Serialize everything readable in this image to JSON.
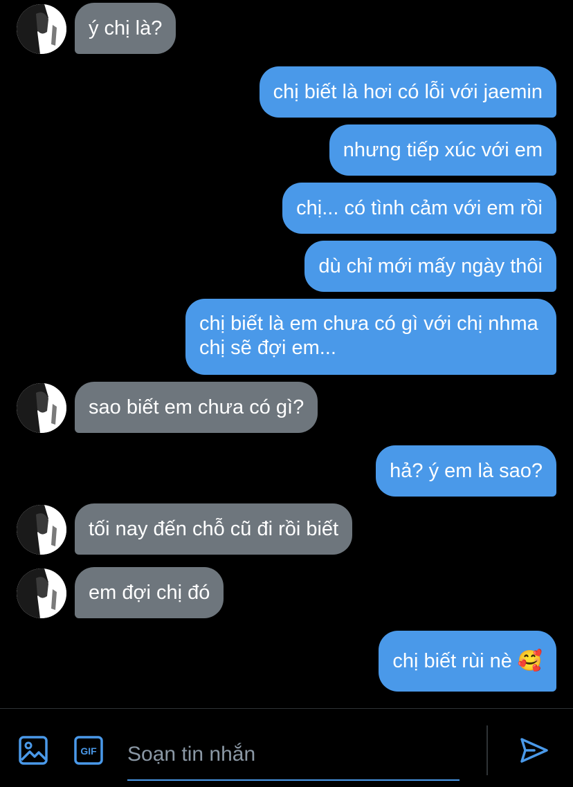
{
  "messages": [
    {
      "side": "in",
      "text": "ý chị là?"
    },
    {
      "side": "out",
      "text": "chị biết là hơi có lỗi với jaemin"
    },
    {
      "side": "out",
      "text": "nhưng tiếp xúc với em"
    },
    {
      "side": "out",
      "text": "chị... có tình cảm với em rồi"
    },
    {
      "side": "out",
      "text": "dù chỉ mới mấy ngày thôi"
    },
    {
      "side": "out",
      "text": "chị biết là em chưa có gì với chị nhma chị sẽ đợi em..."
    },
    {
      "side": "in",
      "text": "sao biết em chưa có gì?"
    },
    {
      "side": "out",
      "text": "hả? ý em là sao?"
    },
    {
      "side": "in",
      "text": "tối nay đến chỗ cũ đi rồi biết"
    },
    {
      "side": "in",
      "text": "em đợi chị đó"
    },
    {
      "side": "out",
      "text": "chị biết rùi nè 🥰"
    }
  ],
  "composer": {
    "placeholder": "Soạn tin nhắn",
    "gif_label": "GIF"
  },
  "colors": {
    "incoming_bubble": "#6e767d",
    "outgoing_bubble": "#4a99e9",
    "accent": "#4a99e9",
    "background": "#000000"
  },
  "icons": {
    "image": "image-icon",
    "gif": "gif-icon",
    "send": "send-icon"
  }
}
